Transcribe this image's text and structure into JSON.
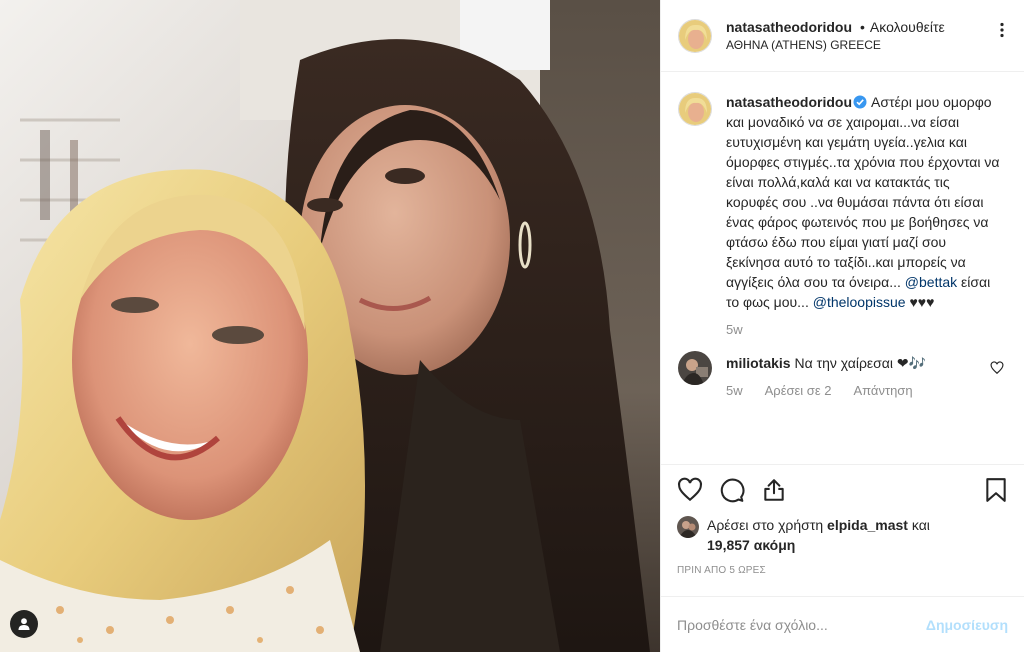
{
  "header": {
    "username": "natasatheodoridou",
    "separator": "•",
    "follow_status": "Ακολουθείτε",
    "location": "ΑΘΗΝΑ (ATHENS) GREECE"
  },
  "caption": {
    "username": "natasatheodoridou",
    "text_main": "Αστέρι μου ομορφο και μοναδικό να σε χαιρομαι...να είσαι ευτυχισμένη και γεμάτη υγεία..γελια και όμορφες στιγμές..τα χρόνια που έρχονται να είναι πολλά,καλά και να κατακτάς τις κορυφές σου ..να θυμάσαι πάντα ότι είσαι ένας φάρος φωτεινός που με βοήθησες να φτάσω έδω που είμαι γιατί μαζί σου ξεκίνησα αυτό το ταξίδι..και μπορείς να αγγίξεις όλα σου τα όνειρα...",
    "mention1": "@bettak",
    "text_mid": "είσαι το φως μου...",
    "mention2": "@theloopissue",
    "text_end": "♥♥♥",
    "time": "5w"
  },
  "comment": {
    "username": "miliotakis",
    "text": "Να την χαίρεσαι ❤🎶",
    "time": "5w",
    "likes": "Αρέσει σε 2",
    "reply": "Απάντηση"
  },
  "likes": {
    "prefix": "Αρέσει στο χρήστη",
    "user": "elpida_mast",
    "and": "και",
    "count": "19,857 ακόμη"
  },
  "time_ago": "ΠΡΙΝ ΑΠΟ 5 ΩΡΕΣ",
  "add_comment": {
    "placeholder": "Προσθέστε ένα σχόλιο...",
    "post_label": "Δημοσίευση"
  },
  "icons": {
    "verified": "verified-badge-icon",
    "more": "more-options-icon",
    "like": "heart-icon",
    "comment": "comment-bubble-icon",
    "share": "share-icon",
    "save": "bookmark-icon",
    "tags": "person-tag-icon"
  },
  "colors": {
    "link": "#003569",
    "verified": "#3897f0",
    "muted": "#8e8e8e",
    "post_button": "#b2dffc",
    "border": "#efefef"
  }
}
